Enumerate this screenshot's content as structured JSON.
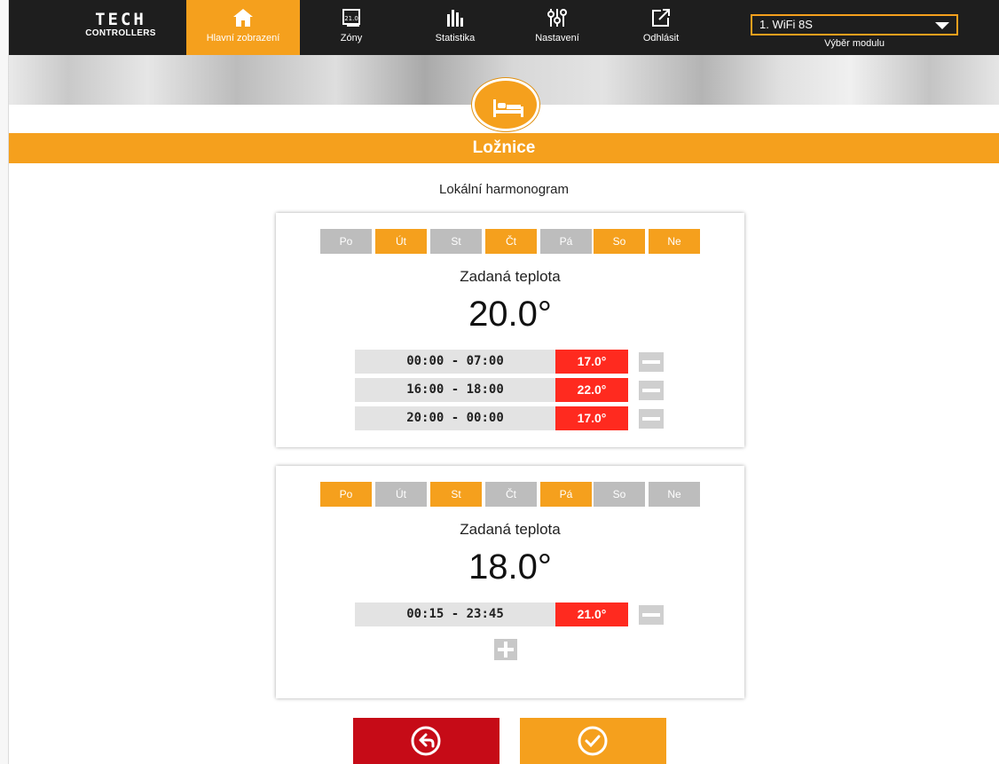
{
  "brand": {
    "line1": "TECH",
    "line2": "CONTROLLERS"
  },
  "nav": [
    {
      "label": "Hlavní zobrazení",
      "icon": "home-icon",
      "active": true
    },
    {
      "label": "Zóny",
      "icon": "zones-icon",
      "badge": "21.0"
    },
    {
      "label": "Statistika",
      "icon": "statistics-icon"
    },
    {
      "label": "Nastavení",
      "icon": "settings-icon"
    },
    {
      "label": "Odhlásit",
      "icon": "logout-icon"
    }
  ],
  "module": {
    "selected": "1. WiFi 8S",
    "label": "Výběr modulu"
  },
  "zone": {
    "title": "Ložnice",
    "icon": "bed-icon"
  },
  "subtitle": "Lokální harmonogram",
  "schedules": [
    {
      "days": [
        {
          "label": "Po",
          "active": false
        },
        {
          "label": "Út",
          "active": true
        },
        {
          "label": "St",
          "active": false
        },
        {
          "label": "Čt",
          "active": true
        },
        {
          "label": "Pá",
          "active": false
        },
        {
          "label": "So",
          "active": true
        },
        {
          "label": "Ne",
          "active": true
        }
      ],
      "set_label": "Zadaná teplota",
      "set_temp": "20.0°",
      "slots": [
        {
          "time": "00:00 - 07:00",
          "temp": "17.0°"
        },
        {
          "time": "16:00 - 18:00",
          "temp": "22.0°"
        },
        {
          "time": "20:00 - 00:00",
          "temp": "17.0°"
        }
      ]
    },
    {
      "days": [
        {
          "label": "Po",
          "active": true
        },
        {
          "label": "Út",
          "active": false
        },
        {
          "label": "St",
          "active": true
        },
        {
          "label": "Čt",
          "active": false
        },
        {
          "label": "Pá",
          "active": true
        },
        {
          "label": "So",
          "active": false
        },
        {
          "label": "Ne",
          "active": false
        }
      ],
      "set_label": "Zadaná teplota",
      "set_temp": "18.0°",
      "slots": [
        {
          "time": "00:15 - 23:45",
          "temp": "21.0°"
        }
      ]
    }
  ],
  "actions": {
    "back_icon": "back-arrow-icon",
    "confirm_icon": "checkmark-icon"
  },
  "colors": {
    "accent": "#f5a01d",
    "nav_bg": "#1e1e1e",
    "slot_temp": "#ff2a1f",
    "back_button": "#c60b17",
    "day_inactive": "#bdbdbd"
  }
}
